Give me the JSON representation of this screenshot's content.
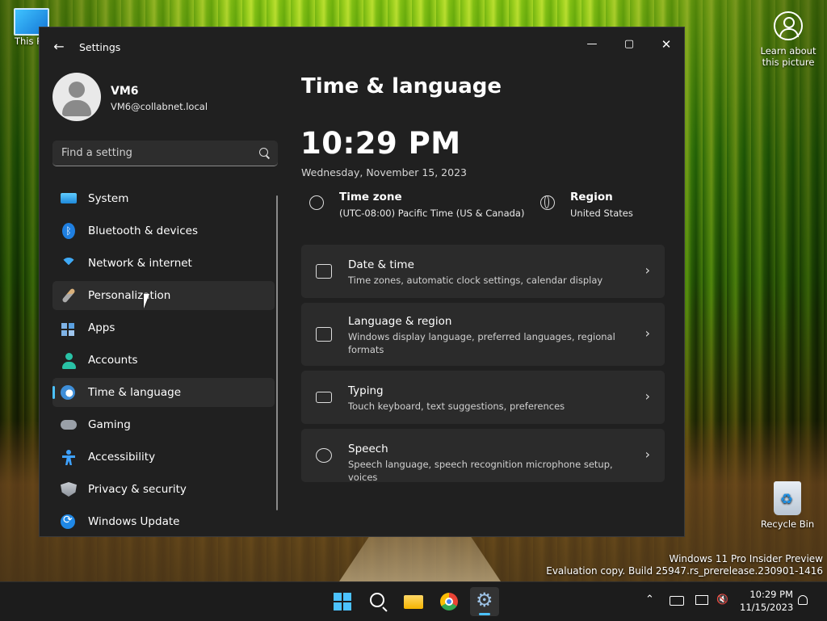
{
  "desktop": {
    "this_pc_label": "This PC",
    "learn_label": "Learn about this picture",
    "recycle_label": "Recycle Bin",
    "watermark_line1": "Windows 11 Pro Insider Preview",
    "watermark_line2": "Evaluation copy. Build 25947.rs_prerelease.230901-1416"
  },
  "window": {
    "title": "Settings",
    "controls": {
      "minimize": "—",
      "maximize": "▢",
      "close": "✕"
    }
  },
  "profile": {
    "name": "VM6",
    "email": "VM6@collabnet.local"
  },
  "search": {
    "placeholder": "Find a setting"
  },
  "nav": {
    "items": [
      {
        "label": "System",
        "icon": "system-icon"
      },
      {
        "label": "Bluetooth & devices",
        "icon": "bluetooth-icon"
      },
      {
        "label": "Network & internet",
        "icon": "wifi-icon"
      },
      {
        "label": "Personalization",
        "icon": "brush-icon",
        "state": "hover"
      },
      {
        "label": "Apps",
        "icon": "apps-icon"
      },
      {
        "label": "Accounts",
        "icon": "accounts-icon"
      },
      {
        "label": "Time & language",
        "icon": "time-language-icon",
        "state": "selected"
      },
      {
        "label": "Gaming",
        "icon": "gamepad-icon"
      },
      {
        "label": "Accessibility",
        "icon": "accessibility-icon"
      },
      {
        "label": "Privacy & security",
        "icon": "shield-icon"
      },
      {
        "label": "Windows Update",
        "icon": "windows-update-icon"
      }
    ]
  },
  "main": {
    "title": "Time & language",
    "clock": "10:29 PM",
    "date": "Wednesday, November 15, 2023",
    "time_zone": {
      "title": "Time zone",
      "value": "(UTC-08:00) Pacific Time (US & Canada)"
    },
    "region": {
      "title": "Region",
      "value": "United States"
    },
    "cards": [
      {
        "title": "Date & time",
        "desc": "Time zones, automatic clock settings, calendar display",
        "icon": "calendar-clock-icon"
      },
      {
        "title": "Language & region",
        "desc": "Windows display language, preferred languages, regional formats",
        "icon": "language-icon"
      },
      {
        "title": "Typing",
        "desc": "Touch keyboard, text suggestions, preferences",
        "icon": "keyboard-icon"
      },
      {
        "title": "Speech",
        "desc": "Speech language, speech recognition microphone setup, voices",
        "icon": "speech-icon"
      }
    ],
    "chevron": "›"
  },
  "taskbar": {
    "tray_chevron": "⌃",
    "time": "10:29 PM",
    "date": "11/15/2023"
  }
}
